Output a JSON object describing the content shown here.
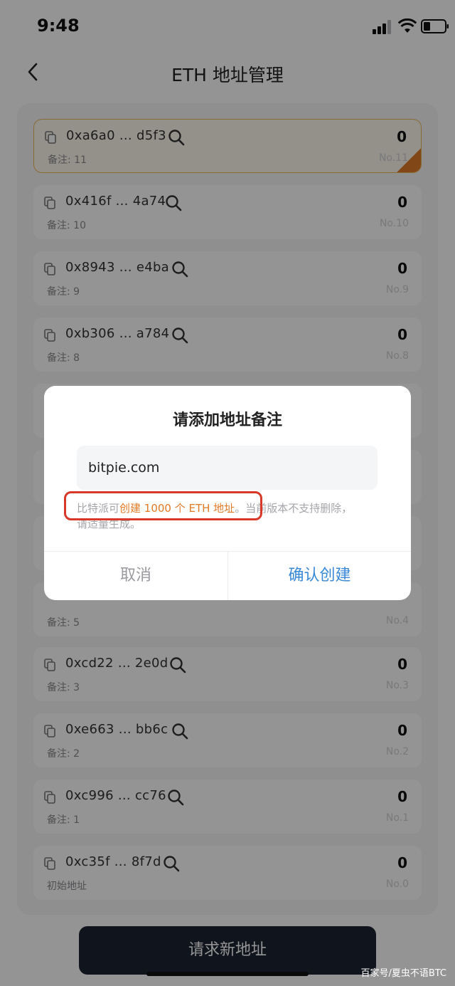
{
  "status_bar": {
    "time": "9:48"
  },
  "nav": {
    "back_label": "<",
    "title": "ETH 地址管理"
  },
  "addresses": [
    {
      "address": "0xa6a0 ... d5f3",
      "balance": "0",
      "note": "备注: 11",
      "no": "No.11",
      "selected": true
    },
    {
      "address": "0x416f ... 4a74",
      "balance": "0",
      "note": "备注: 10",
      "no": "No.10"
    },
    {
      "address": "0x8943 ... e4ba",
      "balance": "0",
      "note": "备注: 9",
      "no": "No.9"
    },
    {
      "address": "0xb306 ... a784",
      "balance": "0",
      "note": "备注: 8",
      "no": "No.8"
    },
    {
      "address": "0xcd22 ... 2e0d",
      "balance": "0",
      "note": "备注: 3",
      "no": "No.3"
    },
    {
      "address": "0xe663 ... bb6c",
      "balance": "0",
      "note": "备注: 2",
      "no": "No.2"
    },
    {
      "address": "0xc996 ... cc76",
      "balance": "0",
      "note": "备注: 1",
      "no": "No.1"
    },
    {
      "address": "0xc35f ... 8f7d",
      "balance": "0",
      "note": "初始地址",
      "no": "No.0"
    }
  ],
  "partial_row": {
    "note": "备注: 5",
    "no": "No.4"
  },
  "bottom_button": {
    "label": "请求新地址"
  },
  "watermark": "百家号/夏虫不语BTC",
  "dialog": {
    "title": "请添加地址备注",
    "input_value": "bitpie.com",
    "hint_prefix": "比特派可",
    "hint_highlight": "创建 1000 个 ETH 地址",
    "hint_suffix": "。当前版本不支持删除，请适量生成。",
    "cancel_label": "取消",
    "confirm_label": "确认创建"
  },
  "colors": {
    "accent": "#e07a28",
    "confirm": "#3a88d8",
    "highlight_box": "#d7382a",
    "dark_button": "#1d2433"
  }
}
